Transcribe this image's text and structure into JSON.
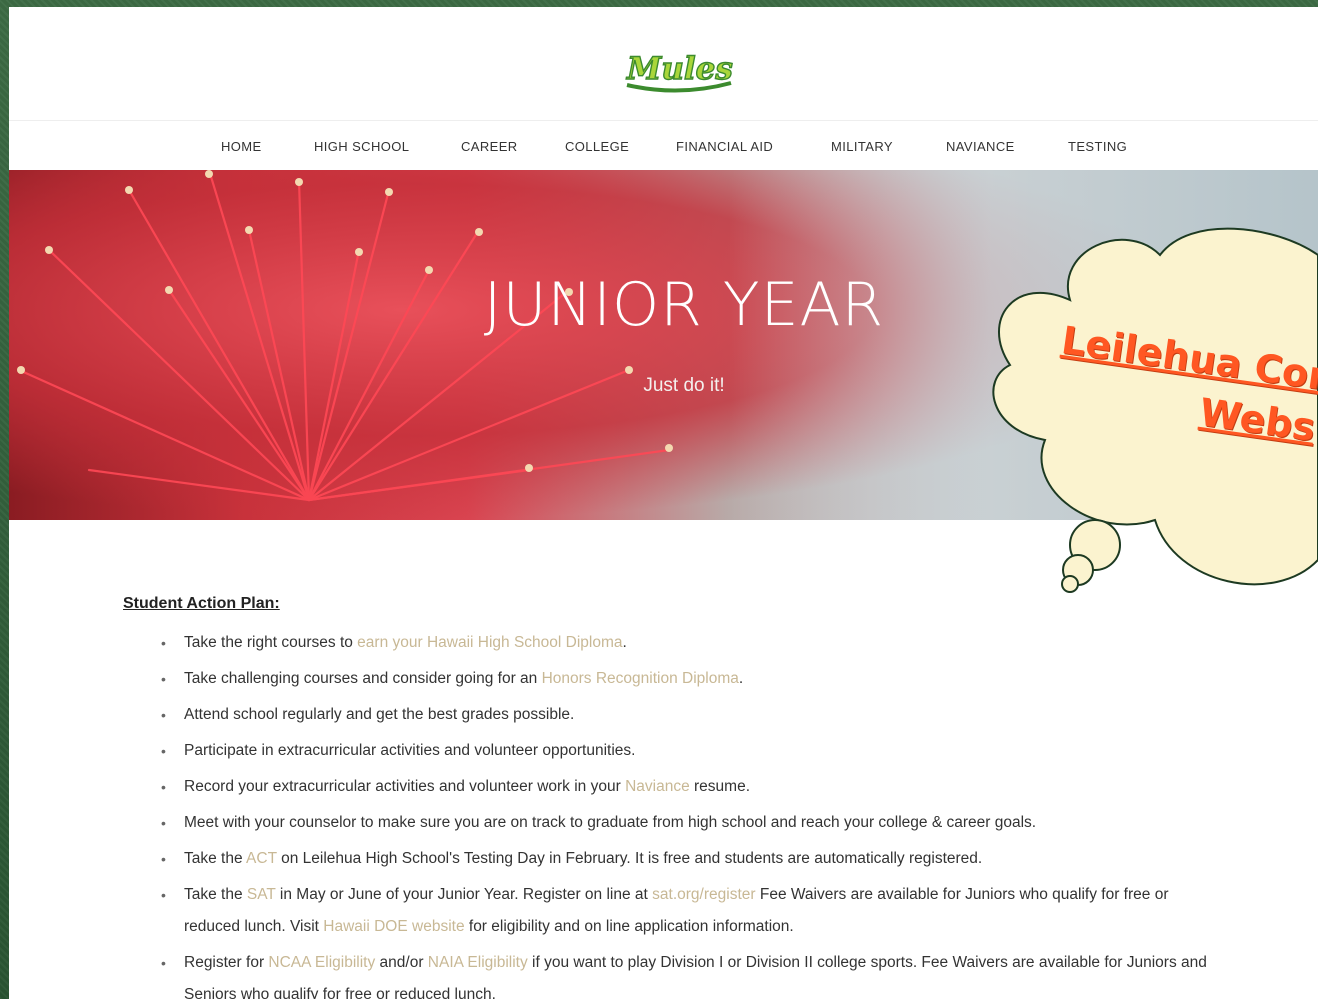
{
  "logo": {
    "text": "Mules"
  },
  "nav": {
    "items": [
      "HOME",
      "HIGH SCHOOL",
      "CAREER",
      "COLLEGE",
      "FINANCIAL AID",
      "MILITARY",
      "NAVIANCE",
      "TESTING"
    ]
  },
  "hero": {
    "title": "JUNIOR YEAR",
    "subtitle": "Just do it!"
  },
  "callout": {
    "line1": "Leilehua Con",
    "line2": "Webs"
  },
  "plan": {
    "heading": "Student Action Plan:",
    "items": [
      {
        "pre": "Take the right courses to ",
        "link": "earn your Hawaii High School Diploma",
        "post": "."
      },
      {
        "pre": "Take challenging courses and consider going for an ",
        "link": "Honors Recognition Diploma",
        "post": "."
      },
      {
        "pre": "Attend school regularly and get the best grades possible.",
        "link": "",
        "post": ""
      },
      {
        "pre": "Participate in extracurricular activities and volunteer opportunities.",
        "link": "",
        "post": ""
      },
      {
        "pre": "Record your extracurricular activities and volunteer work in your ",
        "link": "Naviance",
        "post": " resume."
      },
      {
        "pre": "Meet with your counselor to make sure you are on track to graduate from high school and reach your college & career goals.",
        "link": "",
        "post": ""
      },
      {
        "pre": "Take the ",
        "link": "ACT",
        "post": " on Leilehua High School's Testing Day in February. It is free and students are automatically registered."
      }
    ],
    "sat": {
      "pre": "Take the  ",
      "link1": "SAT",
      "mid1": " in May or June of your Junior Year. Register on line at ",
      "link2": "sat.org/register",
      "mid2": " Fee Waivers are available for Juniors who qualify for free or reduced lunch. Visit ",
      "link3": "Hawaii DOE website",
      "post": " for eligibility and on line application information."
    },
    "ncaa": {
      "pre": "Register for ",
      "link1": "NCAA Eligibility",
      "mid": " and/or ",
      "link2": "NAIA Eligibility",
      "post": " if you want to play Division I or Division II college sports. Fee Waivers are available for Juniors and Seniors who qualify for free or reduced lunch."
    }
  },
  "colors": {
    "accent_link": "#c8b895",
    "frame": "#2f5a38",
    "callout_fill": "#fbf3cf",
    "callout_text": "#ff5722"
  }
}
